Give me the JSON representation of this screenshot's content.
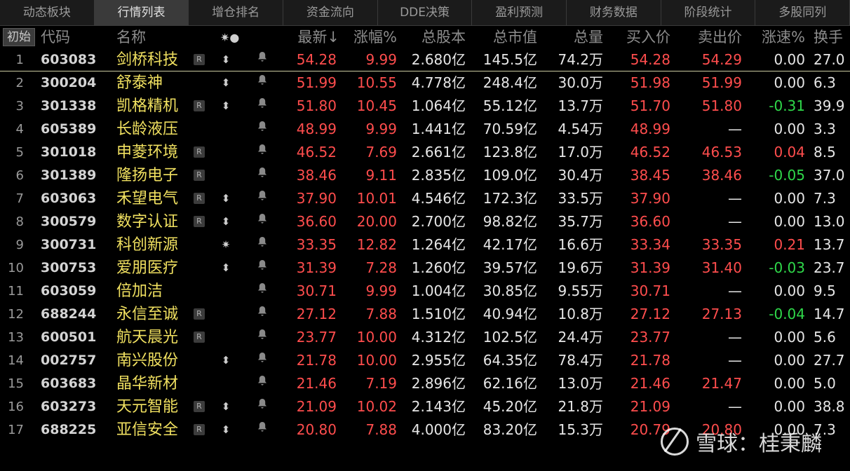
{
  "tabs": [
    "动态板块",
    "行情列表",
    "增仓排名",
    "资金流向",
    "DDE决策",
    "盈利预测",
    "财务数据",
    "阶段统计",
    "多股同列"
  ],
  "active_tab": 1,
  "header": {
    "reset": "初始",
    "code": "代码",
    "name": "名称",
    "icons": "✷●",
    "last": "最新↓",
    "chg": "涨幅%",
    "total_shares": "总股本",
    "market_cap": "总市值",
    "volume": "总量",
    "bid": "买入价",
    "ask": "卖出价",
    "speed": "涨速%",
    "turnover": "换手"
  },
  "rows": [
    {
      "idx": "1",
      "code": "603083",
      "name": "剑桥科技",
      "r": true,
      "flag": "⬍",
      "last": "54.28",
      "chg": "9.99",
      "cap": "2.680亿",
      "mkt": "145.5亿",
      "vol": "74.2万",
      "bid": "54.28",
      "ask": "54.29",
      "spd": "0.00",
      "spd_color": "white",
      "turn": "27.0"
    },
    {
      "idx": "2",
      "code": "300204",
      "name": "舒泰神",
      "r": false,
      "flag": "⬍",
      "last": "51.99",
      "chg": "10.55",
      "cap": "4.778亿",
      "mkt": "248.4亿",
      "vol": "30.0万",
      "bid": "51.98",
      "ask": "51.99",
      "spd": "0.00",
      "spd_color": "white",
      "turn": "6.3"
    },
    {
      "idx": "3",
      "code": "301338",
      "name": "凯格精机",
      "r": true,
      "flag": "⬍",
      "last": "51.80",
      "chg": "10.45",
      "cap": "1.064亿",
      "mkt": "55.12亿",
      "vol": "13.7万",
      "bid": "51.70",
      "ask": "51.80",
      "spd": "-0.31",
      "spd_color": "green",
      "turn": "39.9"
    },
    {
      "idx": "4",
      "code": "605389",
      "name": "长龄液压",
      "r": false,
      "flag": "",
      "last": "48.99",
      "chg": "9.99",
      "cap": "1.441亿",
      "mkt": "70.59亿",
      "vol": "4.54万",
      "bid": "48.99",
      "ask": "—",
      "spd": "0.00",
      "spd_color": "white",
      "turn": "3.3"
    },
    {
      "idx": "5",
      "code": "301018",
      "name": "申菱环境",
      "r": true,
      "flag": "",
      "last": "46.52",
      "chg": "7.69",
      "cap": "2.661亿",
      "mkt": "123.8亿",
      "vol": "17.0万",
      "bid": "46.52",
      "ask": "46.53",
      "spd": "0.04",
      "spd_color": "red",
      "turn": "8.5"
    },
    {
      "idx": "6",
      "code": "301389",
      "name": "隆扬电子",
      "r": true,
      "flag": "",
      "last": "38.46",
      "chg": "9.11",
      "cap": "2.835亿",
      "mkt": "109.0亿",
      "vol": "30.4万",
      "bid": "38.45",
      "ask": "38.46",
      "spd": "-0.05",
      "spd_color": "green",
      "turn": "37.0"
    },
    {
      "idx": "7",
      "code": "603063",
      "name": "禾望电气",
      "r": true,
      "flag": "⬍",
      "last": "37.90",
      "chg": "10.01",
      "cap": "4.546亿",
      "mkt": "172.3亿",
      "vol": "33.5万",
      "bid": "37.90",
      "ask": "—",
      "spd": "0.00",
      "spd_color": "white",
      "turn": "7.3"
    },
    {
      "idx": "8",
      "code": "300579",
      "name": "数字认证",
      "r": true,
      "flag": "⬍",
      "last": "36.60",
      "chg": "20.00",
      "cap": "2.700亿",
      "mkt": "98.82亿",
      "vol": "35.7万",
      "bid": "36.60",
      "ask": "—",
      "spd": "0.00",
      "spd_color": "white",
      "turn": "13.0"
    },
    {
      "idx": "9",
      "code": "300731",
      "name": "科创新源",
      "r": false,
      "flag": "✷",
      "last": "33.35",
      "chg": "12.82",
      "cap": "1.264亿",
      "mkt": "42.17亿",
      "vol": "16.6万",
      "bid": "33.34",
      "ask": "33.35",
      "spd": "0.21",
      "spd_color": "red",
      "turn": "13.7"
    },
    {
      "idx": "10",
      "code": "300753",
      "name": "爱朋医疗",
      "r": false,
      "flag": "⬍",
      "last": "31.39",
      "chg": "7.28",
      "cap": "1.260亿",
      "mkt": "39.57亿",
      "vol": "19.6万",
      "bid": "31.39",
      "ask": "31.40",
      "spd": "-0.03",
      "spd_color": "green",
      "turn": "23.7"
    },
    {
      "idx": "11",
      "code": "603059",
      "name": "倍加洁",
      "r": false,
      "flag": "",
      "last": "30.71",
      "chg": "9.99",
      "cap": "1.004亿",
      "mkt": "30.85亿",
      "vol": "9.55万",
      "bid": "30.71",
      "ask": "—",
      "spd": "0.00",
      "spd_color": "white",
      "turn": "9.5"
    },
    {
      "idx": "12",
      "code": "688244",
      "name": "永信至诚",
      "r": true,
      "flag": "",
      "last": "27.12",
      "chg": "7.88",
      "cap": "1.510亿",
      "mkt": "40.94亿",
      "vol": "10.8万",
      "bid": "27.12",
      "ask": "27.13",
      "spd": "-0.04",
      "spd_color": "green",
      "turn": "14.7"
    },
    {
      "idx": "13",
      "code": "600501",
      "name": "航天晨光",
      "r": true,
      "flag": "",
      "last": "23.77",
      "chg": "10.00",
      "cap": "4.312亿",
      "mkt": "102.5亿",
      "vol": "24.4万",
      "bid": "23.77",
      "ask": "—",
      "spd": "0.00",
      "spd_color": "white",
      "turn": "5.6"
    },
    {
      "idx": "14",
      "code": "002757",
      "name": "南兴股份",
      "r": false,
      "flag": "⬍",
      "last": "21.78",
      "chg": "10.00",
      "cap": "2.955亿",
      "mkt": "64.35亿",
      "vol": "78.4万",
      "bid": "21.78",
      "ask": "—",
      "spd": "0.00",
      "spd_color": "white",
      "turn": "27.7"
    },
    {
      "idx": "15",
      "code": "603683",
      "name": "晶华新材",
      "r": false,
      "flag": "",
      "last": "21.46",
      "chg": "7.19",
      "cap": "2.896亿",
      "mkt": "62.16亿",
      "vol": "13.0万",
      "bid": "21.46",
      "ask": "21.47",
      "spd": "0.00",
      "spd_color": "white",
      "turn": "5.0"
    },
    {
      "idx": "16",
      "code": "603273",
      "name": "天元智能",
      "r": true,
      "flag": "⬍",
      "last": "21.09",
      "chg": "10.02",
      "cap": "2.143亿",
      "mkt": "45.20亿",
      "vol": "21.8万",
      "bid": "21.09",
      "ask": "—",
      "spd": "0.00",
      "spd_color": "white",
      "turn": "38.8"
    },
    {
      "idx": "17",
      "code": "688225",
      "name": "亚信安全",
      "r": true,
      "flag": "⬍",
      "last": "20.80",
      "chg": "7.88",
      "cap": "4.000亿",
      "mkt": "83.20亿",
      "vol": "15.3万",
      "bid": "20.79",
      "ask": "20.80",
      "spd": "0.00",
      "spd_color": "white",
      "turn": "7.3"
    }
  ],
  "r_badge": "R",
  "bell_icon": "♠",
  "watermark": "雪球：桂秉麟",
  "colors": {
    "up": "#ff4d4d",
    "down": "#2fd84a",
    "name": "#f0e060",
    "bg": "#000000"
  }
}
